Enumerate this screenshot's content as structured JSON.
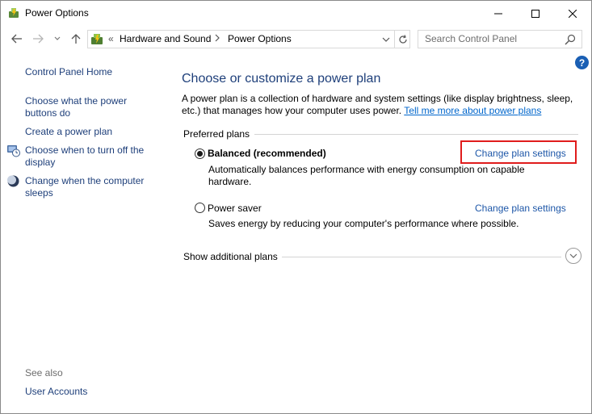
{
  "window": {
    "title": "Power Options"
  },
  "address": {
    "overflow": "«",
    "crumbs": [
      "Hardware and Sound",
      "Power Options"
    ]
  },
  "search": {
    "placeholder": "Search Control Panel"
  },
  "help": {
    "label": "?"
  },
  "sidebar": {
    "home": "Control Panel Home",
    "links": [
      "Choose what the power buttons do",
      "Create a power plan",
      "Choose when to turn off the display",
      "Change when the computer sleeps"
    ],
    "see_also": "See also",
    "see_also_links": [
      "User Accounts"
    ]
  },
  "main": {
    "heading": "Choose or customize a power plan",
    "description": "A power plan is a collection of hardware and system settings (like display brightness, sleep, etc.) that manages how your computer uses power.",
    "description_link": "Tell me more about power plans",
    "preferred_label": "Preferred plans",
    "plans": [
      {
        "name": "Balanced (recommended)",
        "selected": true,
        "description": "Automatically balances performance with energy consumption on capable hardware.",
        "link": "Change plan settings"
      },
      {
        "name": "Power saver",
        "selected": false,
        "description": "Saves energy by reducing your computer's performance where possible.",
        "link": "Change plan settings"
      }
    ],
    "additional": "Show additional plans"
  },
  "colors": {
    "link": "#1e57a8",
    "heading": "#1e3f7a",
    "highlight": "#e01c1c"
  }
}
